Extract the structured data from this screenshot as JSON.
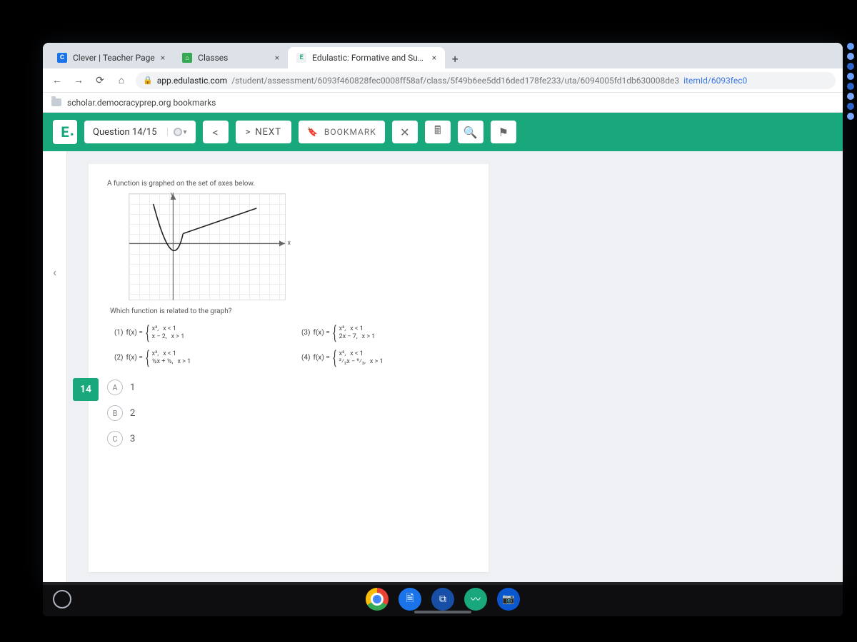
{
  "tabs": [
    {
      "title": "Clever | Teacher Page",
      "favicon_bg": "#1a73e8",
      "favicon_text": "C",
      "active": false
    },
    {
      "title": "Classes",
      "favicon_bg": "#34a853",
      "favicon_text": "⌂",
      "active": false
    },
    {
      "title": "Edulastic: Formative and Summ",
      "favicon_bg": "#f0f2f5",
      "favicon_text": "E",
      "favicon_fg": "#19a87c",
      "active": true
    }
  ],
  "omnibox": {
    "host": "app.edulastic.com",
    "path": "/student/assessment/6093f460828fec0008ff58af/class/5f49b6ee5dd16ded178fe233/uta/6094005fd1db630008de3",
    "frag": "itemId/6093fec0"
  },
  "bookmarks": {
    "item1": "scholar.democracyprep.org bookmarks"
  },
  "app": {
    "logo": "E",
    "question_chip": "Question 14/15",
    "next_label": "NEXT",
    "bookmark_label": "BOOKMARK",
    "prev_glyph": "<",
    "next_glyph": ">",
    "close_glyph": "✕",
    "calc_glyph": "🖩",
    "search_glyph": "🔍",
    "mark_glyph": "🔖"
  },
  "question": {
    "number": "14",
    "prompt_top": "A function is graphed on the set of axes below.",
    "prompt_bottom": "Which function is related to the graph?",
    "y_label": "y",
    "x_label": "x",
    "fx_label": "f(x) =",
    "options_math": [
      {
        "n": "(1)",
        "p1a": "x²,",
        "p1b": "x < 1",
        "p2a": "x − 2,",
        "p2b": "x > 1"
      },
      {
        "n": "(3)",
        "p1a": "x²,",
        "p1b": "x < 1",
        "p2a": "2x − 7,",
        "p2b": "x > 1"
      },
      {
        "n": "(2)",
        "p1a": "x²,",
        "p1b": "x < 1",
        "p2a": "½x + ½,",
        "p2b": "x > 1"
      },
      {
        "n": "(4)",
        "p1a": "x²,",
        "p1b": "x < 1",
        "p2a": "³⁄₂x − ⁹⁄₂,",
        "p2b": "x > 1"
      }
    ],
    "answers": [
      {
        "letter": "A",
        "text": "1"
      },
      {
        "letter": "B",
        "text": "2"
      },
      {
        "letter": "C",
        "text": "3"
      }
    ]
  }
}
